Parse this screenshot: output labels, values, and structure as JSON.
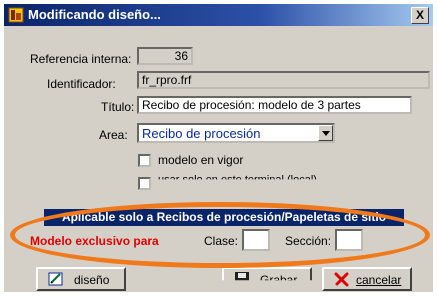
{
  "window": {
    "title": "Modificando diseño...",
    "close_label": "X"
  },
  "form": {
    "ref_label": "Referencia interna:",
    "ref_value": "36",
    "id_label": "Identificador:",
    "id_value": "fr_rpro.frf",
    "title_label": "Título:",
    "title_value": "Recibo de procesión: modelo de 3 partes",
    "area_label": "Area:",
    "area_value": "Recibo de procesión",
    "vigor_label": "modelo en vigor",
    "terminal_label": "usar solo en este terminal (local)"
  },
  "section": {
    "banner": "Aplicable solo a Recibos de procesión/Papeletas de sitio",
    "exclusive_label": "Modelo exclusivo para",
    "clase_label": "Clase:",
    "clase_value": "",
    "seccion_label": "Sección:",
    "seccion_value": ""
  },
  "buttons": {
    "design": "diseño",
    "save": "Grabar",
    "cancel": "cancelar"
  },
  "colors": {
    "title_bar": "#0a246a",
    "highlight_oval": "#f07a1b",
    "exclusive_text": "#e00000",
    "area_text": "#0b2a9c"
  }
}
